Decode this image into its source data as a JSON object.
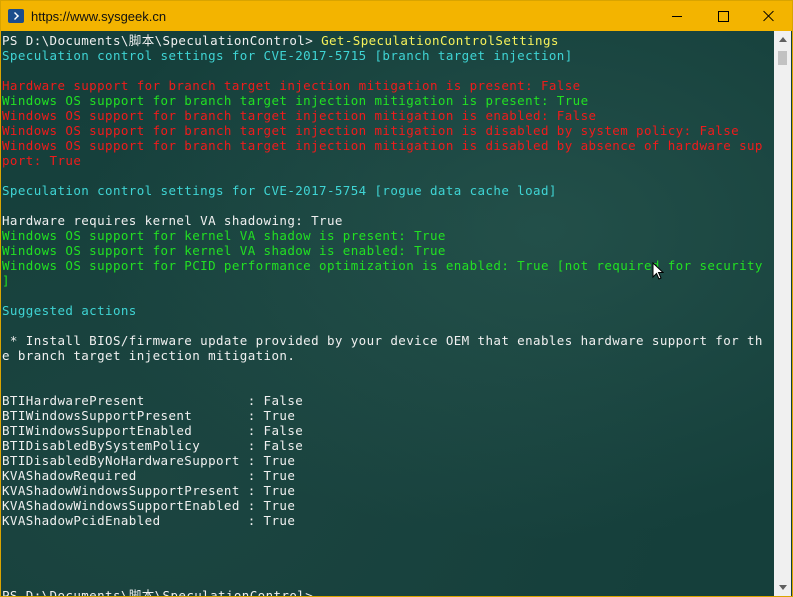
{
  "window": {
    "title": "https://www.sysgeek.cn",
    "icon": "powershell-icon",
    "controls": [
      "minimize-icon",
      "maximize-icon",
      "close-icon"
    ]
  },
  "console": {
    "lines": [
      [
        {
          "t": "PS D:\\Documents\\脚本\\SpeculationControl> ",
          "c": "w"
        },
        {
          "t": "Get-SpeculationControlSettings",
          "c": "y"
        }
      ],
      [
        {
          "t": "Speculation control settings for CVE-2017-5715 [branch target injection]",
          "c": "c"
        }
      ],
      [],
      [
        {
          "t": "Hardware support for branch target injection mitigation is present: False",
          "c": "r"
        }
      ],
      [
        {
          "t": "Windows OS support for branch target injection mitigation is present: True",
          "c": "g"
        }
      ],
      [
        {
          "t": "Windows OS support for branch target injection mitigation is enabled: False",
          "c": "r"
        }
      ],
      [
        {
          "t": "Windows OS support for branch target injection mitigation is disabled by system policy: False",
          "c": "r"
        }
      ],
      [
        {
          "t": "Windows OS support for branch target injection mitigation is disabled by absence of hardware sup",
          "c": "r"
        }
      ],
      [
        {
          "t": "port: True",
          "c": "r"
        }
      ],
      [],
      [
        {
          "t": "Speculation control settings for CVE-2017-5754 [rogue data cache load]",
          "c": "c"
        }
      ],
      [],
      [
        {
          "t": "Hardware requires kernel VA shadowing: True",
          "c": "w"
        }
      ],
      [
        {
          "t": "Windows OS support for kernel VA shadow is present: True",
          "c": "g"
        }
      ],
      [
        {
          "t": "Windows OS support for kernel VA shadow is enabled: True",
          "c": "g"
        }
      ],
      [
        {
          "t": "Windows OS support for PCID performance optimization is enabled: True [not required for security",
          "c": "g"
        }
      ],
      [
        {
          "t": "]",
          "c": "g"
        }
      ],
      [],
      [
        {
          "t": "Suggested actions",
          "c": "c"
        }
      ],
      [],
      [
        {
          "t": " * Install BIOS/firmware update provided by your device OEM that enables hardware support for th",
          "c": "w"
        }
      ],
      [
        {
          "t": "e branch target injection mitigation.",
          "c": "w"
        }
      ],
      [],
      [],
      [
        {
          "t": "BTIHardwarePresent             : False",
          "c": "w"
        }
      ],
      [
        {
          "t": "BTIWindowsSupportPresent       : True",
          "c": "w"
        }
      ],
      [
        {
          "t": "BTIWindowsSupportEnabled       : False",
          "c": "w"
        }
      ],
      [
        {
          "t": "BTIDisabledBySystemPolicy      : False",
          "c": "w"
        }
      ],
      [
        {
          "t": "BTIDisabledByNoHardwareSupport : True",
          "c": "w"
        }
      ],
      [
        {
          "t": "KVAShadowRequired              : True",
          "c": "w"
        }
      ],
      [
        {
          "t": "KVAShadowWindowsSupportPresent : True",
          "c": "w"
        }
      ],
      [
        {
          "t": "KVAShadowWindowsSupportEnabled : True",
          "c": "w"
        }
      ],
      [
        {
          "t": "KVAShadowPcidEnabled           : True",
          "c": "w"
        }
      ],
      [],
      [],
      [],
      [],
      [
        {
          "t": "PS D:\\Documents\\脚本\\SpeculationControl> ",
          "c": "w"
        }
      ]
    ]
  },
  "scrollbar": {
    "up": "arrow-up-icon",
    "down": "arrow-down-icon"
  },
  "colors": {
    "titlebar": "#f3b400",
    "console_bg": "#153f3b",
    "command": "#f7f25a",
    "heading": "#3fd4d4",
    "false_status": "#f01b1b",
    "true_status": "#22e022"
  }
}
